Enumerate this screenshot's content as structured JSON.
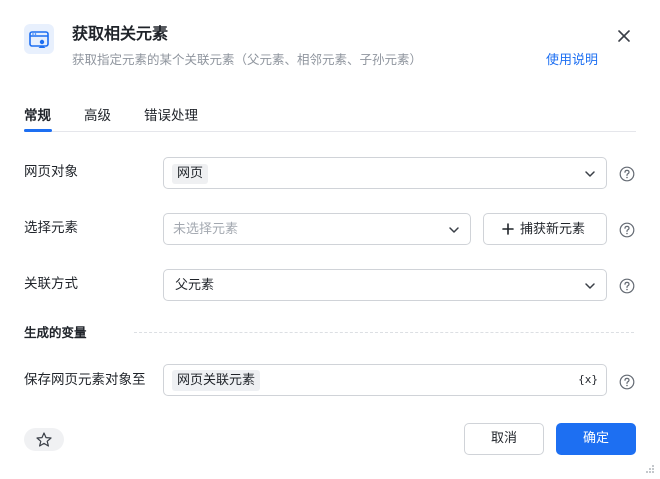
{
  "header": {
    "title": "获取相关元素",
    "subtitle": "获取指定元素的某个关联元素（父元素、相邻元素、子孙元素）",
    "help_link": "使用说明",
    "icon": "browser-element-icon"
  },
  "tabs": [
    {
      "label": "常规",
      "active": true
    },
    {
      "label": "高级",
      "active": false
    },
    {
      "label": "错误处理",
      "active": false
    }
  ],
  "form": {
    "webpage": {
      "label": "网页对象",
      "value": "网页"
    },
    "element": {
      "label": "选择元素",
      "placeholder": "未选择元素",
      "capture_label": "捕获新元素"
    },
    "relation": {
      "label": "关联方式",
      "value": "父元素"
    }
  },
  "output": {
    "section_title": "生成的变量",
    "save_label": "保存网页元素对象至",
    "variable": "网页关联元素",
    "var_button": "{x}"
  },
  "footer": {
    "cancel_label": "取消",
    "ok_label": "确定"
  },
  "colors": {
    "accent": "#1d6ff2",
    "border": "#d0d3d8",
    "text": "#1f2329",
    "muted": "#8f959e"
  }
}
